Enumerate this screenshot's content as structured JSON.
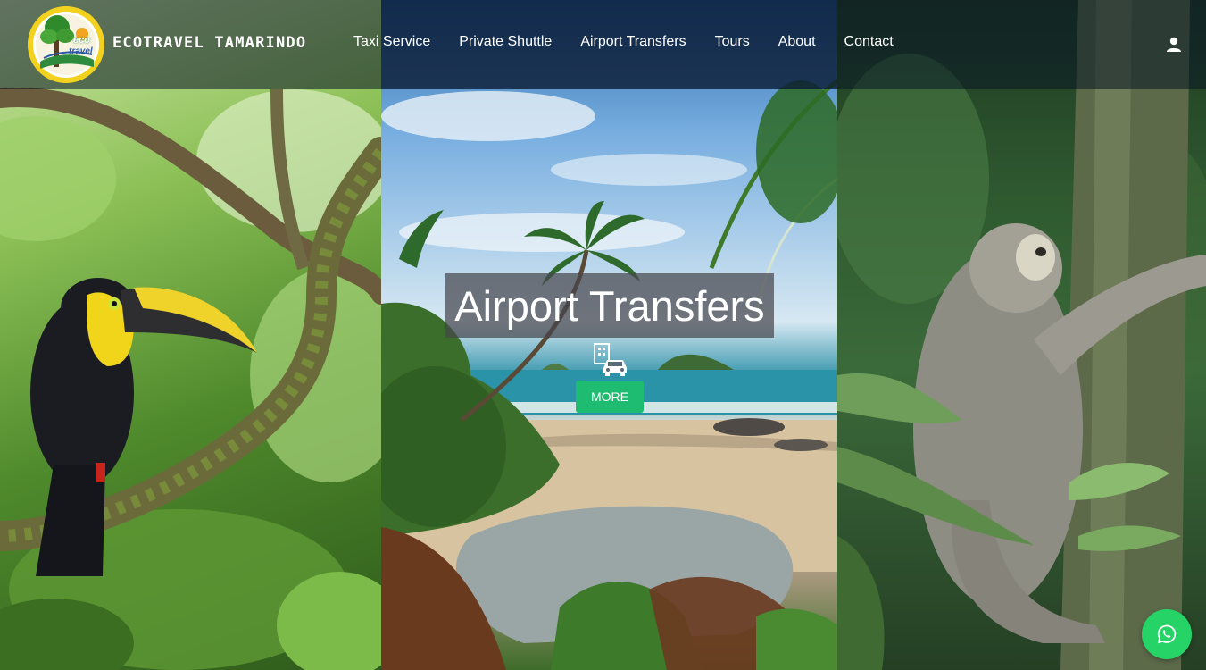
{
  "header": {
    "site_title": "ECOTRAVEL TAMARINDO",
    "logo": {
      "top_text": "eco",
      "bottom_text": "travel",
      "icon": "tree-logo-icon"
    }
  },
  "nav": {
    "items": [
      {
        "label": "Taxi Service"
      },
      {
        "label": "Private Shuttle"
      },
      {
        "label": "Airport Transfers"
      },
      {
        "label": "Tours"
      },
      {
        "label": "About"
      },
      {
        "label": "Contact"
      }
    ],
    "user_icon": "user-icon"
  },
  "hero": {
    "title": "Airport Transfers",
    "icon": "building-car-icon",
    "button_label": "MORE",
    "button_color": "#1ebc71"
  },
  "panels": {
    "left": {
      "subject": "toucan-photo"
    },
    "middle": {
      "subject": "beach-photo"
    },
    "right": {
      "subject": "sloth-photo"
    }
  },
  "floating": {
    "whatsapp_icon": "whatsapp-icon",
    "whatsapp_color": "#25d366"
  },
  "colors": {
    "header_overlay": "#08141c",
    "accent": "#1ebc71",
    "logo_yellow": "#f3d21f"
  }
}
